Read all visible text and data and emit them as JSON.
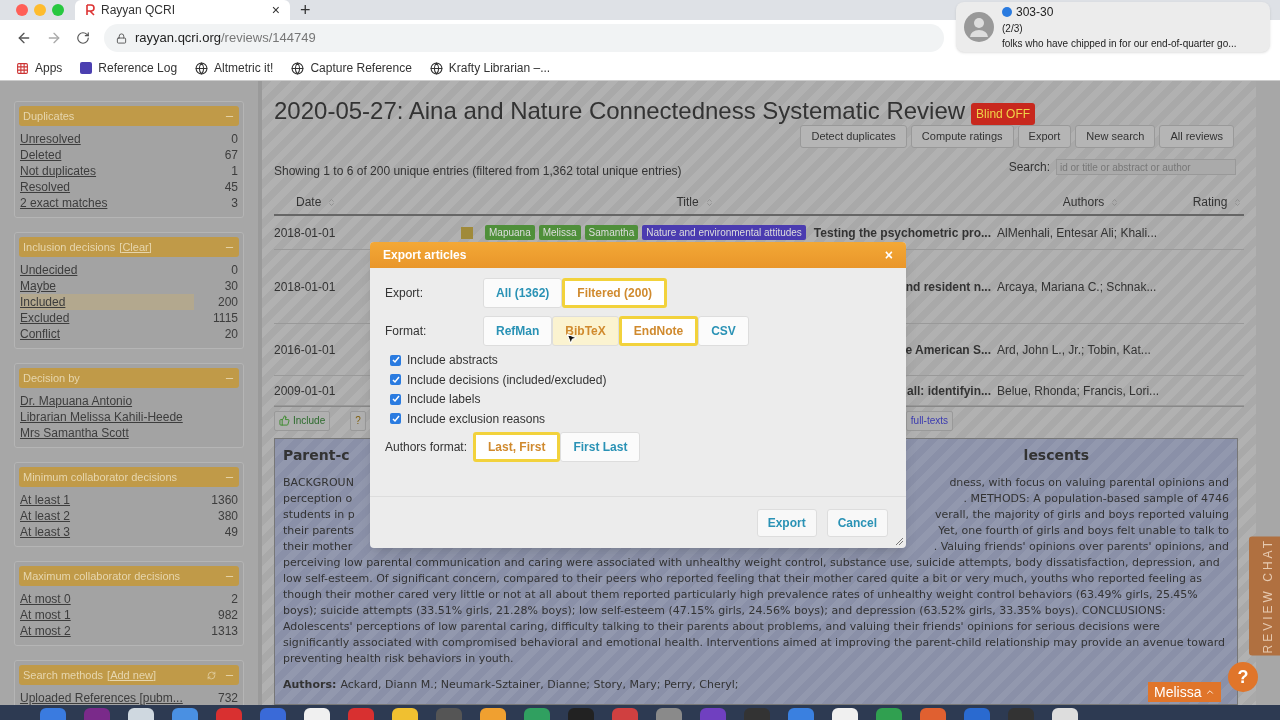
{
  "browser": {
    "tab_title": "Rayyan QCRI",
    "close": "×",
    "new_tab": "+",
    "url_host": "rayyan.qcri.org",
    "url_path": "/reviews/144749",
    "bookmarks": [
      {
        "label": "Apps",
        "kind": "apps"
      },
      {
        "label": "Reference Log",
        "kind": "square"
      },
      {
        "label": "Altmetric it!",
        "kind": "globe"
      },
      {
        "label": "Capture Reference",
        "kind": "globe"
      },
      {
        "label": "Krafty Librarian –...",
        "kind": "globe"
      }
    ]
  },
  "notification": {
    "title": "303-30",
    "counter": "(2/3)",
    "message": "folks who have chipped in for our end-of-quarter go..."
  },
  "sidebar": {
    "sections": [
      {
        "title": "Duplicates",
        "refresh": false,
        "items": [
          {
            "label": "Unresolved",
            "count": "0",
            "selected": false
          },
          {
            "label": "Deleted",
            "count": "67",
            "selected": false
          },
          {
            "label": "Not duplicates",
            "count": "1",
            "selected": false
          },
          {
            "label": "Resolved",
            "count": "45",
            "selected": false
          },
          {
            "label": "2 exact matches",
            "count": "3",
            "selected": false
          }
        ]
      },
      {
        "title": "Inclusion decisions",
        "action": "[Clear]",
        "refresh": false,
        "items": [
          {
            "label": "Undecided",
            "count": "0",
            "selected": false
          },
          {
            "label": "Maybe",
            "count": "30",
            "selected": false
          },
          {
            "label": "Included",
            "count": "200",
            "selected": true
          },
          {
            "label": "Excluded",
            "count": "1115",
            "selected": false
          },
          {
            "label": "Conflict",
            "count": "20",
            "selected": false
          }
        ]
      },
      {
        "title": "Decision by",
        "refresh": false,
        "items": [
          {
            "label": "Dr. Mapuana Antonio",
            "selected": false
          },
          {
            "label": "Librarian Melissa Kahili-Heede",
            "selected": false
          },
          {
            "label": "Mrs Samantha Scott",
            "selected": false
          }
        ]
      },
      {
        "title": "Minimum collaborator decisions",
        "refresh": false,
        "items": [
          {
            "label": "At least 1",
            "count": "1360",
            "selected": false
          },
          {
            "label": "At least 2",
            "count": "380",
            "selected": false
          },
          {
            "label": "At least 3",
            "count": "49",
            "selected": false
          }
        ]
      },
      {
        "title": "Maximum collaborator decisions",
        "refresh": false,
        "items": [
          {
            "label": "At most 0",
            "count": "2",
            "selected": false
          },
          {
            "label": "At most 1",
            "count": "982",
            "selected": false
          },
          {
            "label": "At most 2",
            "count": "1313",
            "selected": false
          }
        ]
      },
      {
        "title": "Search methods",
        "action": "[Add new]",
        "refresh": true,
        "items": [
          {
            "label": "Uploaded References [pubm...",
            "count": "732",
            "selected": false
          }
        ]
      }
    ]
  },
  "review": {
    "title": "2020-05-27: Aina and Nature Connectedness Systematic Review",
    "blind_badge": "Blind OFF",
    "buttons": [
      "Detect duplicates",
      "Compute ratings",
      "Export",
      "New search",
      "All reviews"
    ],
    "showing": "Showing 1 to 6 of 200 unique entries (filtered from 1,362 total unique entries)",
    "search_label": "Search:",
    "search_placeholder": "id or title or abstract or author",
    "columns": [
      "Date",
      "Title",
      "Authors",
      "Rating"
    ],
    "rows": [
      {
        "date": "2018-01-01",
        "labels": [
          {
            "text": "Mapuana",
            "color": "#4f8f3a"
          },
          {
            "text": "Melissa",
            "color": "#4f8f3a"
          },
          {
            "text": "Samantha",
            "color": "#4f8f3a"
          },
          {
            "text": "Nature and environmental attitudes",
            "color": "#4a3bb0"
          }
        ],
        "title": "Testing the psychometric pro...",
        "authors": "AlMenhali, Entesar Ali; Khali..."
      },
      {
        "date": "2018-01-01",
        "labels": [],
        "title": "nd resident n...",
        "authors": "Arcaya, Mariana C.; Schnak..."
      },
      {
        "date": "2016-01-01",
        "labels": [],
        "title": "e American S...",
        "authors": "Ard, John L., Jr.; Tobin, Kat..."
      },
      {
        "date": "2009-01-01",
        "labels": [],
        "title": "all: identifyin...",
        "authors": "Belue, Rhonda; Francis, Lori..."
      }
    ],
    "toolbar": [
      {
        "label": "Include",
        "kind": "include"
      },
      {
        "label": "?",
        "kind": "maybe"
      },
      {
        "label": "full-texts",
        "kind": "fulltext"
      }
    ],
    "abstract": {
      "title_left": "Parent-c",
      "title_right": "lescents",
      "partial_lines": [
        {
          "left": "BACKGROUN",
          "right": "dness, with focus on valuing parental opinions and"
        },
        {
          "left": "perception o",
          "right": ". METHODS: A population-based sample of 4746"
        },
        {
          "left": "students in p",
          "right": "verall, the majority of girls and boys reported valuing"
        },
        {
          "left": "their parents",
          "right": "Yet, one fourth of girls and boys felt unable to talk to"
        },
        {
          "left": "their mother",
          "right": ". Valuing friends' opinions over parents' opinions, and"
        }
      ],
      "text": "perceiving low parental communication and caring were associated with unhealthy weight control, substance use, suicide attempts, body dissatisfaction, depression, and low self-esteem. Of significant concern, compared to their peers who reported feeling that their mother cared quite a bit or very much, youths who reported feeling as though their mother cared very little or not at all about them reported particularly high prevalence rates of unhealthy weight control behaviors (63.49% girls, 25.45% boys); suicide attempts (33.51% girls, 21.28% boys); low self-esteem (47.15% girls, 24.56% boys); and depression (63.52% girls, 33.35% boys). CONCLUSIONS: Adolescents' perceptions of low parental caring, difficulty talking to their parents about problems, and valuing their friends' opinions for serious decisions were significantly associated with compromised behavioral and emotional health. Interventions aimed at improving the parent-child relationship may provide an avenue toward preventing health risk behaviors in youth.",
      "authors_label": "Authors:",
      "authors": "Ackard, Diann M.; Neumark-Sztainer, Dianne; Story, Mary; Perry, Cheryl;"
    }
  },
  "modal": {
    "title": "Export articles",
    "close": "×",
    "export_label": "Export:",
    "export_options": [
      {
        "label": "All (1362)",
        "selected": false
      },
      {
        "label": "Filtered (200)",
        "selected": true
      }
    ],
    "format_label": "Format:",
    "format_options": [
      {
        "label": "RefMan",
        "selected": false,
        "hovered": false
      },
      {
        "label": "BibTeX",
        "selected": false,
        "hovered": true
      },
      {
        "label": "EndNote",
        "selected": true,
        "hovered": false
      },
      {
        "label": "CSV",
        "selected": false,
        "hovered": false
      }
    ],
    "checkboxes": [
      {
        "label": "Include abstracts",
        "checked": true
      },
      {
        "label": "Include decisions (included/excluded)",
        "checked": true
      },
      {
        "label": "Include labels",
        "checked": true
      },
      {
        "label": "Include exclusion reasons",
        "checked": true
      }
    ],
    "authors_label": "Authors format:",
    "authors_options": [
      {
        "label": "Last, First",
        "selected": true
      },
      {
        "label": "First Last",
        "selected": false
      }
    ],
    "buttons": [
      "Export",
      "Cancel"
    ]
  },
  "chat_tab": "REVIEW CHAT",
  "help": "?",
  "user": "Melissa"
}
